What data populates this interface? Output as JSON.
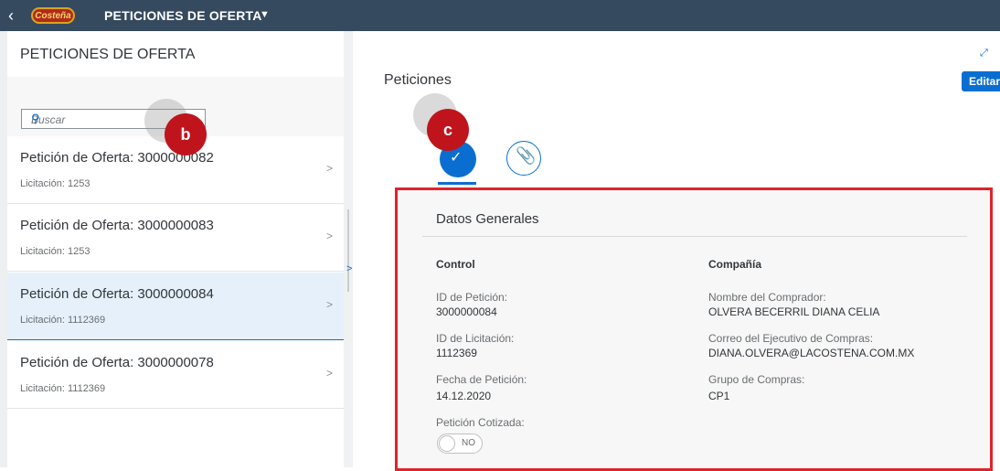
{
  "shell": {
    "back_glyph": "‹",
    "logo_text": "Costeña",
    "app_title": "PETICIONES DE OFERTA",
    "caret_glyph": "▼"
  },
  "master": {
    "header": "PETICIONES DE OFERTA",
    "search": {
      "placeholder": "Buscar",
      "icon": "search-icon"
    },
    "items": [
      {
        "title": "Petición de Oferta: 3000000082",
        "subtitle": "Licitación: 1253",
        "selected": false
      },
      {
        "title": "Petición de Oferta: 3000000083",
        "subtitle": "Licitación: 1253",
        "selected": false
      },
      {
        "title": "Petición de Oferta: 3000000084",
        "subtitle": "Licitación: 1112369",
        "selected": true
      },
      {
        "title": "Petición de Oferta: 3000000078",
        "subtitle": "Licitación: 1112369",
        "selected": false
      }
    ]
  },
  "detail": {
    "title": "Peticiones",
    "edit_label": "Editar",
    "section_title": "Datos Generales",
    "control": {
      "title": "Control",
      "id_peticion_label": "ID de Petición:",
      "id_peticion_value": "3000000084",
      "id_licitacion_label": "ID de Licitación:",
      "id_licitacion_value": "1112369",
      "fecha_label": "Fecha de Petición:",
      "fecha_value": "14.12.2020",
      "cotizada_label": "Petición Cotizada:",
      "cotizada_value": "NO"
    },
    "compania": {
      "title": "Compañía",
      "comprador_label": "Nombre del Comprador:",
      "comprador_value": "OLVERA BECERRIL DIANA CELIA",
      "correo_label": "Correo del Ejecutivo de Compras:",
      "correo_value": "DIANA.OLVERA@LACOSTENA.COM.MX",
      "grupo_label": "Grupo de Compras:",
      "grupo_value": "CP1"
    }
  },
  "callouts": {
    "b": "b",
    "c": "c"
  },
  "colors": {
    "shell": "#354a5f",
    "accent": "#0a6ed1",
    "highlight": "#e0232b",
    "badge": "#c0141d"
  }
}
